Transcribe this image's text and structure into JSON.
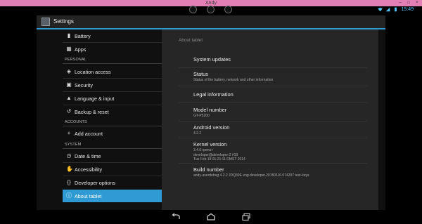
{
  "window": {
    "title": "Andy"
  },
  "status_bar": {
    "time": "15:49"
  },
  "action_bar": {
    "title": "Settings",
    "icon": "settings-app-icon"
  },
  "sidebar": {
    "items": [
      {
        "label": "Battery",
        "icon": "battery-icon"
      },
      {
        "label": "Apps",
        "icon": "apps-icon"
      },
      {
        "header": "PERSONAL"
      },
      {
        "label": "Location access",
        "icon": "location-icon"
      },
      {
        "label": "Security",
        "icon": "lock-icon"
      },
      {
        "label": "Language & input",
        "icon": "keyboard-icon"
      },
      {
        "label": "Backup & reset",
        "icon": "backup-icon"
      },
      {
        "header": "ACCOUNTS"
      },
      {
        "label": "Add account",
        "icon": "add-icon"
      },
      {
        "header": "SYSTEM"
      },
      {
        "label": "Date & time",
        "icon": "clock-icon"
      },
      {
        "label": "Accessibility",
        "icon": "hand-icon"
      },
      {
        "label": "Developer options",
        "icon": "braces-icon"
      },
      {
        "label": "About tablet",
        "icon": "info-icon",
        "selected": true
      }
    ]
  },
  "detail": {
    "breadcrumb": "About tablet",
    "items": [
      {
        "title": "System updates"
      },
      {
        "title": "Status",
        "subtitle": "Status of the battery, network and other information"
      },
      {
        "title": "Legal information"
      },
      {
        "title": "Model number",
        "subtitle": "GT-P5200"
      },
      {
        "title": "Android version",
        "subtitle": "4.2.2"
      },
      {
        "title": "Kernel version",
        "subtitle_lines": [
          "3.4.0-qemu+",
          "developer@developer-2 #19",
          "Tue Feb 18 01:21:11 DMST 2014"
        ]
      },
      {
        "title": "Build number",
        "subtitle": "andy-userdebug 4.2.2 JDQ39E eng.developer.20150116.074207 test-keys"
      }
    ]
  },
  "nav_bar": {
    "back_icon": "back-icon",
    "home_icon": "home-icon",
    "recents_icon": "recents-icon"
  }
}
